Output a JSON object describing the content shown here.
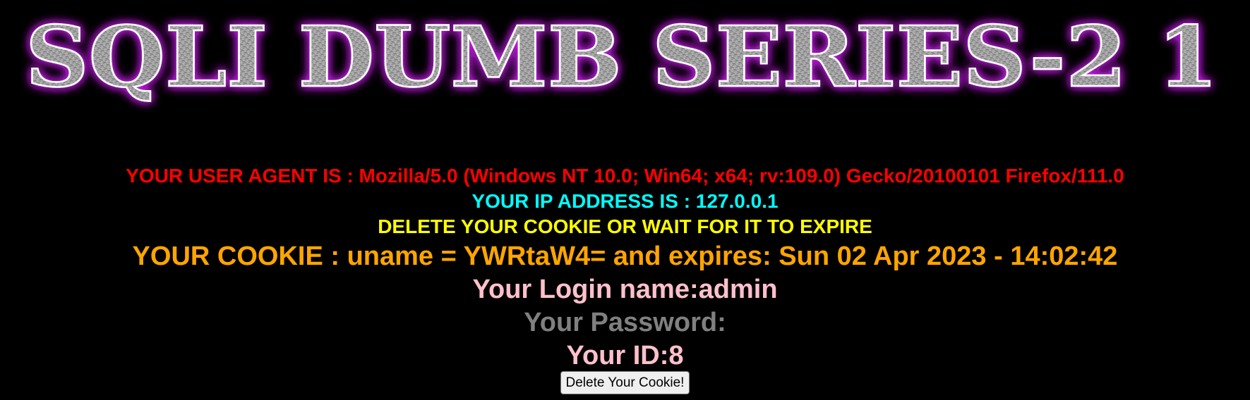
{
  "banner": {
    "text": "SQLI DUMB SERIES-21",
    "display": "SQLI DUMB SERIES-2 1",
    "glow_color": "#c020e0",
    "letter_color": "#9a9a9a"
  },
  "info": {
    "user_agent": "YOUR USER AGENT IS : Mozilla/5.0 (Windows NT 10.0; Win64; x64; rv:109.0) Gecko/20100101 Firefox/111.0",
    "ip_address": "YOUR IP ADDRESS IS : 127.0.0.1",
    "delete_notice": "DELETE YOUR COOKIE OR WAIT FOR IT TO EXPIRE",
    "cookie": "YOUR COOKIE : uname = YWRtaW4= and expires: Sun 02 Apr 2023 - 14:02:42",
    "login_name": "Your Login name:admin",
    "password": "Your Password:",
    "user_id": "Your ID:8"
  },
  "actions": {
    "delete_cookie_label": "Delete Your Cookie!"
  },
  "colors": {
    "background": "#000000",
    "user_agent": "#ff0000",
    "ip_address": "#00ffff",
    "delete_notice": "#ffff00",
    "cookie": "#ffa500",
    "login_name": "#ffc0cb",
    "password": "#808080",
    "user_id": "#ffc0cb"
  }
}
